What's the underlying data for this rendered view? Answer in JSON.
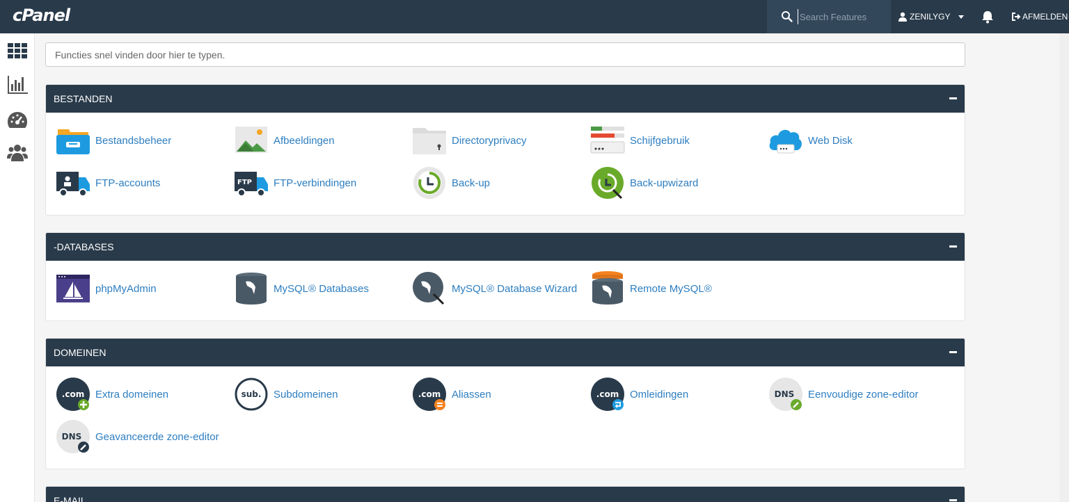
{
  "header": {
    "logo": "cPanel",
    "search_placeholder": "Search Features",
    "username": "ZENILYGY",
    "logout_label": "AFMELDEN"
  },
  "sidebar": {
    "items": [
      {
        "icon": "grid-icon"
      },
      {
        "icon": "bar-chart-icon"
      },
      {
        "icon": "dashboard-gauge-icon"
      },
      {
        "icon": "users-icon"
      }
    ]
  },
  "quick_find": {
    "placeholder": "Functies snel vinden door hier te typen."
  },
  "colors": {
    "header_bg": "#293a4a",
    "link": "#2d7ec0",
    "bg": "#f5f5f5"
  },
  "panels": [
    {
      "title": "BESTANDEN",
      "items": [
        {
          "label": "Bestandsbeheer",
          "icon": "file-manager-icon"
        },
        {
          "label": "Afbeeldingen",
          "icon": "images-icon"
        },
        {
          "label": "Directoryprivacy",
          "icon": "directory-privacy-icon"
        },
        {
          "label": "Schijfgebruik",
          "icon": "disk-usage-icon"
        },
        {
          "label": "Web Disk",
          "icon": "web-disk-icon"
        },
        {
          "label": "FTP-accounts",
          "icon": "ftp-accounts-icon"
        },
        {
          "label": "FTP-verbindingen",
          "icon": "ftp-connections-icon"
        },
        {
          "label": "Back-up",
          "icon": "backup-icon"
        },
        {
          "label": "Back-upwizard",
          "icon": "backup-wizard-icon"
        }
      ]
    },
    {
      "title": "-DATABASES",
      "items": [
        {
          "label": "phpMyAdmin",
          "icon": "phpmyadmin-icon"
        },
        {
          "label": "MySQL® Databases",
          "icon": "mysql-databases-icon"
        },
        {
          "label": "MySQL® Database Wizard",
          "icon": "mysql-wizard-icon"
        },
        {
          "label": "Remote MySQL®",
          "icon": "remote-mysql-icon"
        }
      ]
    },
    {
      "title": "DOMEINEN",
      "items": [
        {
          "label": "Extra domeinen",
          "icon": "addon-domains-icon",
          "badge_text": ".com"
        },
        {
          "label": "Subdomeinen",
          "icon": "subdomains-icon",
          "badge_text": "sub."
        },
        {
          "label": "Aliassen",
          "icon": "aliases-icon",
          "badge_text": ".com"
        },
        {
          "label": "Omleidingen",
          "icon": "redirects-icon",
          "badge_text": ".com"
        },
        {
          "label": "Eenvoudige zone-editor",
          "icon": "simple-zone-editor-icon",
          "badge_text": "DNS"
        },
        {
          "label": "Geavanceerde zone-editor",
          "icon": "advanced-zone-editor-icon",
          "badge_text": "DNS"
        }
      ]
    },
    {
      "title": "E-MAIL",
      "items": []
    }
  ]
}
